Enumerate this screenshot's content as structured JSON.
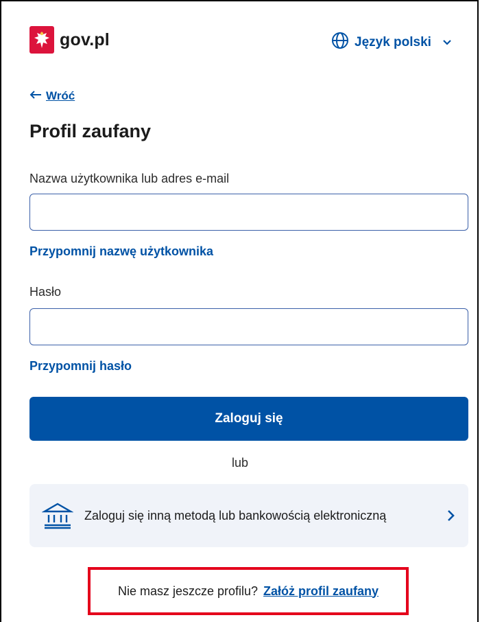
{
  "header": {
    "logo_text": "gov.pl",
    "language_label": "Język polski"
  },
  "nav": {
    "back_label": "Wróć"
  },
  "page": {
    "title": "Profil zaufany"
  },
  "form": {
    "username_label": "Nazwa użytkownika lub adres e-mail",
    "username_value": "",
    "remind_username": "Przypomnij nazwę użytkownika",
    "password_label": "Hasło",
    "password_value": "",
    "remind_password": "Przypomnij hasło",
    "login_button": "Zaloguj się",
    "or_text": "lub",
    "alt_login_text": "Zaloguj się inną metodą lub bankowością elektroniczną"
  },
  "signup": {
    "prompt": "Nie masz jeszcze profilu?",
    "link": "Załóż profil zaufany"
  },
  "colors": {
    "primary": "#0052a5",
    "emblem": "#dc143c",
    "highlight": "#e4001b",
    "alt_bg": "#f0f3f9"
  },
  "icons": {
    "emblem": "polish-eagle-icon",
    "language": "globe-icon",
    "language_toggle": "chevron-down-icon",
    "back": "arrow-left-icon",
    "alt_login": "bank-icon",
    "alt_arrow": "chevron-right-icon"
  }
}
